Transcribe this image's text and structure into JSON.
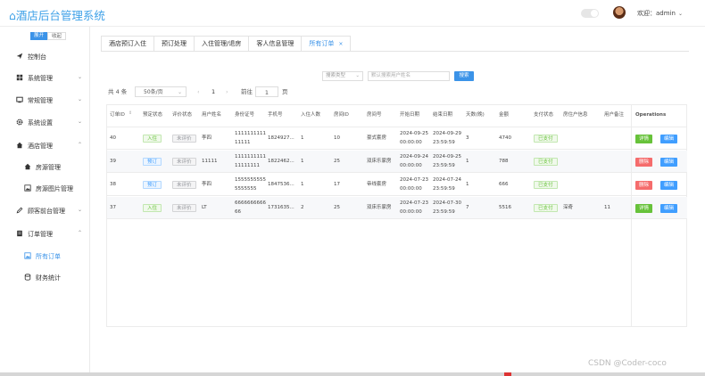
{
  "header": {
    "logo": "⌂酒店后台管理系统",
    "welcome": "欢迎：admin",
    "colors": {
      "accent": "#3b93e8"
    }
  },
  "sidebar": {
    "expand_label": "展开",
    "collapse_label": "收起",
    "items": [
      {
        "label": "控制台",
        "icon": "send-icon"
      },
      {
        "label": "系统管理",
        "icon": "grid-icon"
      },
      {
        "label": "常规管理",
        "icon": "monitor-icon"
      },
      {
        "label": "系统设置",
        "icon": "gear-icon"
      },
      {
        "label": "酒店管理",
        "icon": "home-icon"
      },
      {
        "label": "房源管理",
        "icon": "home-icon"
      },
      {
        "label": "房源图片管理",
        "icon": "image-icon"
      },
      {
        "label": "顾客前台管理",
        "icon": "pencil-icon"
      },
      {
        "label": "订单管理",
        "icon": "document-icon"
      },
      {
        "label": "所有订单",
        "icon": "image-icon"
      },
      {
        "label": "财务统计",
        "icon": "database-icon"
      }
    ]
  },
  "tabs": [
    "酒店预订入住",
    "预订处理",
    "入住管理/退房",
    "客人信息管理",
    "所有订单"
  ],
  "search": {
    "select_placeholder": "搜索类型",
    "input_placeholder": "默认搜索用户姓名",
    "button_label": "搜索"
  },
  "pager": {
    "total": "共 4 条",
    "page_size": "50条/页",
    "prev": "‹",
    "current": "1",
    "next": "›",
    "goto_label": "前往",
    "goto_value": "1",
    "page_unit": "页"
  },
  "table": {
    "columns": [
      "订单ID",
      "预定状态",
      "评价状态",
      "用户姓名",
      "身份证号",
      "手机号",
      "入住人数",
      "房间ID",
      "房间号",
      "开始日期",
      "结束日期",
      "天数(晚)",
      "金额",
      "支付状态",
      "房住户信息",
      "用户备注",
      "Operations"
    ],
    "rows": [
      {
        "id": "40",
        "status": "入住",
        "review": "未评价",
        "name": "李四",
        "idcard1": "1111111111",
        "idcard2": "11111",
        "phone": "1824927...",
        "people": "1",
        "room_id": "10",
        "room_no": "豪式套房",
        "start1": "2024-09-25",
        "start2": "00:00:00",
        "end1": "2024-09-29",
        "end2": "23:59:59",
        "days": "3",
        "amount": "4740",
        "pay": "已支付",
        "occupant": "",
        "remark": "",
        "op1": "详情",
        "op2": "编辑"
      },
      {
        "id": "39",
        "status": "预订",
        "review": "未评价",
        "name": "11111",
        "idcard1": "1111111111",
        "idcard2": "11111111",
        "phone": "1822462...",
        "people": "1",
        "room_id": "25",
        "room_no": "双床乐家房",
        "start1": "2024-09-24",
        "start2": "00:00:00",
        "end1": "2024-09-25",
        "end2": "23:59:59",
        "days": "1",
        "amount": "788",
        "pay": "已支付",
        "occupant": "",
        "remark": "",
        "op1": "删除",
        "op2": "编辑"
      },
      {
        "id": "38",
        "status": "预订",
        "review": "未评价",
        "name": "李四",
        "idcard1": "1555555555",
        "idcard2": "5555555",
        "phone": "1847536...",
        "people": "1",
        "room_id": "17",
        "room_no": "帝线套房",
        "start1": "2024-07-23",
        "start2": "00:00:00",
        "end1": "2024-07-24",
        "end2": "23:59:59",
        "days": "1",
        "amount": "666",
        "pay": "已支付",
        "occupant": "",
        "remark": "",
        "op1": "删除",
        "op2": "编辑"
      },
      {
        "id": "37",
        "status": "入住",
        "review": "未评价",
        "name": "LT",
        "idcard1": "6666666666",
        "idcard2": "66",
        "phone": "1731635...",
        "people": "2",
        "room_id": "25",
        "room_no": "双床乐家房",
        "start1": "2024-07-23",
        "start2": "00:00:00",
        "end1": "2024-07-30",
        "end2": "23:59:59",
        "days": "7",
        "amount": "5516",
        "pay": "已支付",
        "occupant": "深奇",
        "remark": "11",
        "op1": "详情",
        "op2": "编辑"
      }
    ]
  },
  "watermark": "CSDN @Coder-coco"
}
